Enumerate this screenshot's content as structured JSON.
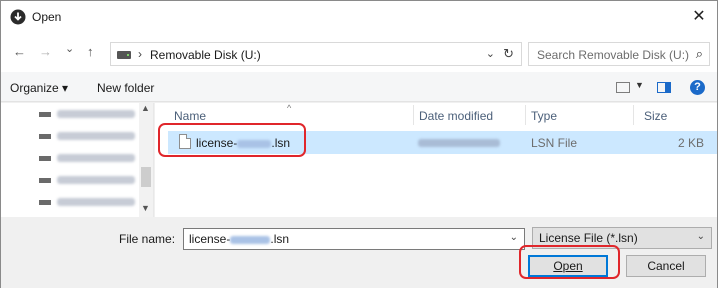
{
  "window": {
    "title": "Open",
    "close_glyph": "✕"
  },
  "nav": {
    "back_glyph": "←",
    "forward_glyph": "→",
    "recent_glyph": "⌄",
    "up_glyph": "↑",
    "address": {
      "separator": "›",
      "crumb": "Removable Disk (U:)",
      "dropdown_glyph": "⌄",
      "refresh_glyph": "↻"
    },
    "search": {
      "placeholder": "Search Removable Disk (U:)",
      "icon": "⌕"
    }
  },
  "toolbar": {
    "organize_label": "Organize ▾",
    "new_folder_label": "New folder",
    "view_dropdown_glyph": "▼",
    "help_glyph": "?"
  },
  "left_pane": {
    "items": [
      {
        "icon": "drive-icon"
      },
      {
        "icon": "drive-icon"
      },
      {
        "icon": "drive-icon"
      },
      {
        "icon": "drive-icon"
      },
      {
        "icon": "drive-icon"
      }
    ],
    "scroll_up_glyph": "▲",
    "scroll_down_glyph": "▼"
  },
  "file_list": {
    "columns": {
      "name": "Name",
      "date": "Date modified",
      "type": "Type",
      "size": "Size"
    },
    "sort_glyph": "^",
    "rows": [
      {
        "name_prefix": "license-",
        "name_suffix": ".lsn",
        "type": "LSN File",
        "size": "2 KB"
      }
    ]
  },
  "bottom": {
    "file_name_label": "File name:",
    "file_name_prefix": "license-",
    "file_name_suffix": ".lsn",
    "dropdown_glyph": "⌄",
    "file_type_value": "License File (*.lsn)",
    "open_label": "Open",
    "cancel_label": "Cancel"
  },
  "colors": {
    "accent": "#0078d7",
    "selection": "#cce8ff",
    "highlight_annotation": "#e0262b"
  }
}
